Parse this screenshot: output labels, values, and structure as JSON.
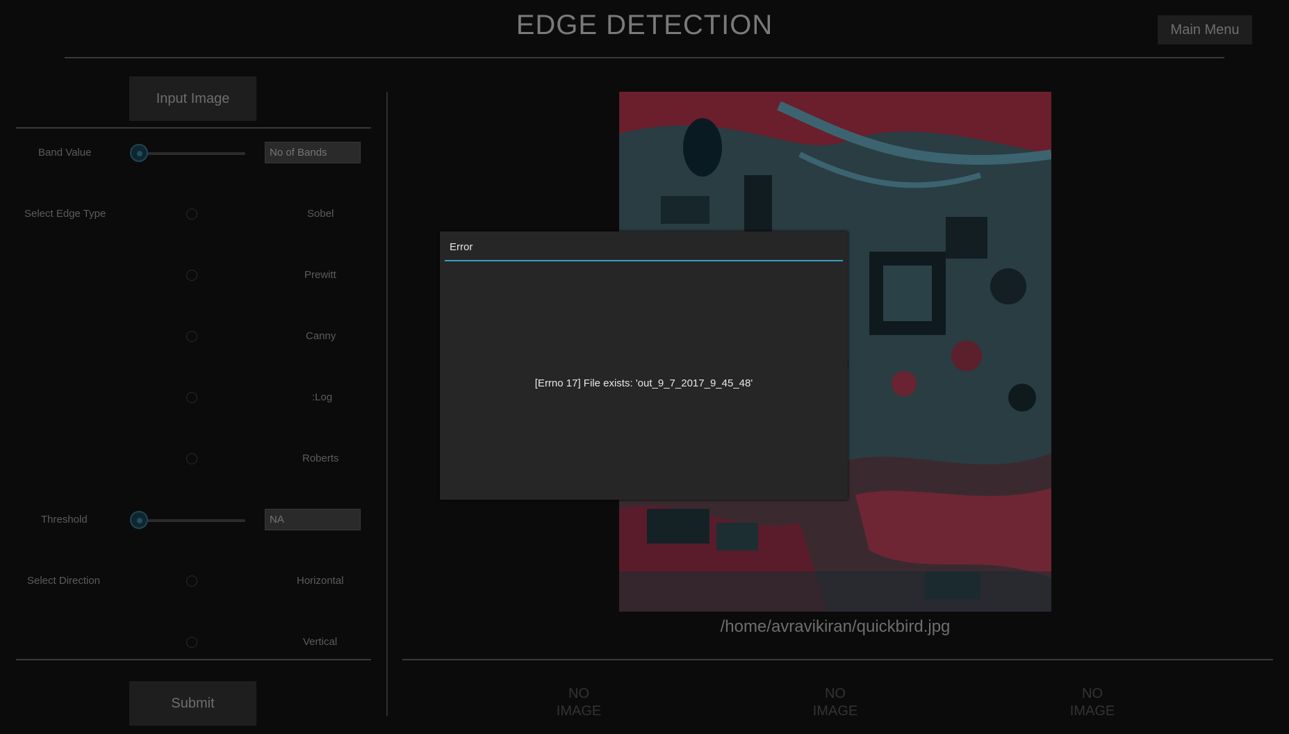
{
  "header": {
    "title": "EDGE DETECTION",
    "main_menu_label": "Main Menu"
  },
  "left_panel": {
    "input_image_label": "Input Image",
    "band_value_label": "Band Value",
    "band_value": 0,
    "band_placeholder": "No of Bands",
    "edge_type_label": "Select Edge Type",
    "edge_types": [
      "Sobel",
      "Prewitt",
      "Canny",
      ":Log",
      "Roberts"
    ],
    "threshold_label": "Threshold",
    "threshold": 0,
    "threshold_placeholder": "NA",
    "direction_label": "Select Direction",
    "directions": [
      "Horizontal",
      "Vertical"
    ],
    "submit_label": "Submit"
  },
  "main": {
    "image_path": "/home/avravikiran/quickbird.jpg",
    "outputs": [
      {
        "line1": "NO",
        "line2": "IMAGE"
      },
      {
        "line1": "NO",
        "line2": "IMAGE"
      },
      {
        "line1": "NO",
        "line2": "IMAGE"
      }
    ]
  },
  "dialog": {
    "title": "Error",
    "message": "[Errno 17] File exists: 'out_9_7_2017_9_45_48'"
  },
  "colors": {
    "accent": "#3a9fc4",
    "background": "#0b0b0b",
    "dialog_bg": "#262626"
  }
}
